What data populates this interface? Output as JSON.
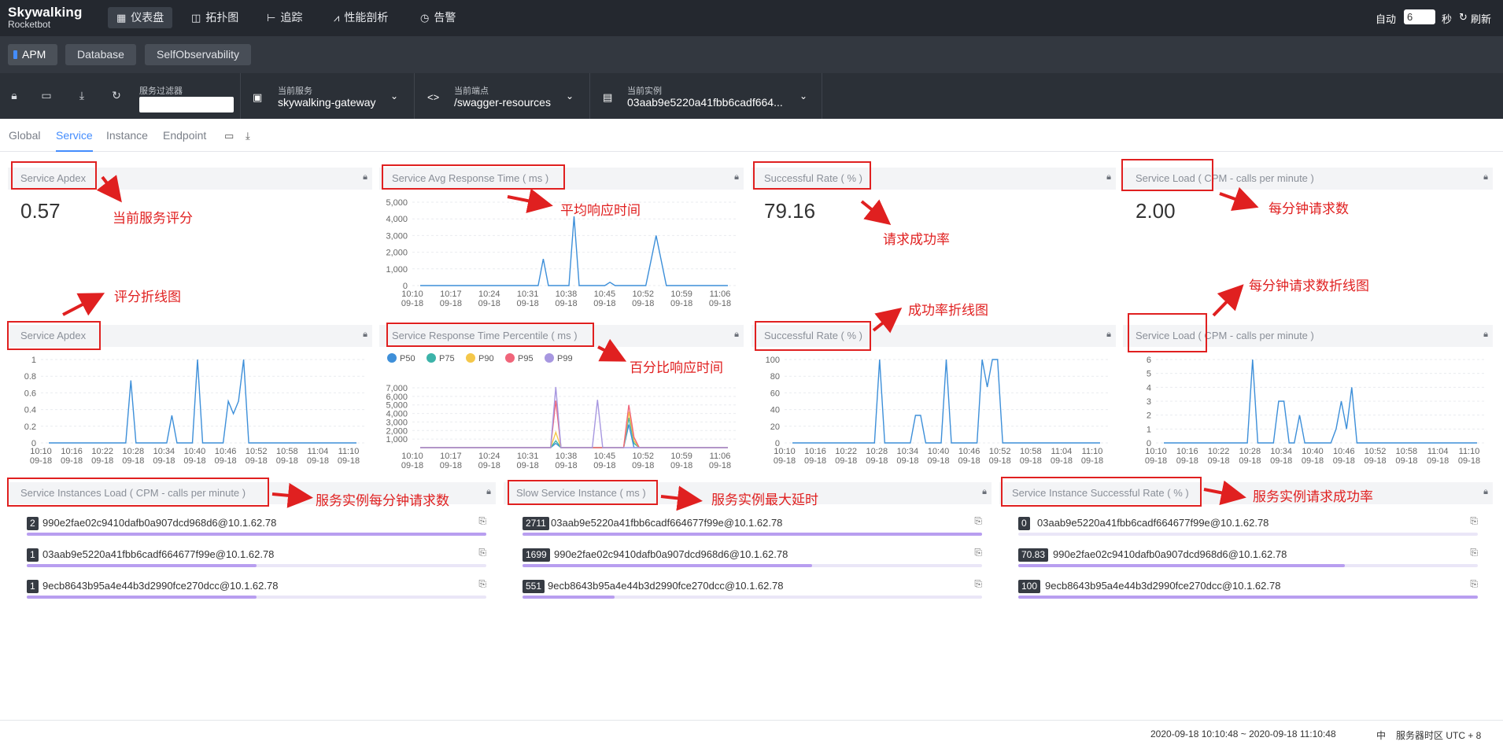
{
  "brand": {
    "line1": "Skywalking",
    "line2": "Rocketbot"
  },
  "nav": [
    {
      "icon": "dashboard-icon",
      "glyph": "▦",
      "label": "仪表盘",
      "active": true
    },
    {
      "icon": "topology-icon",
      "glyph": "◫",
      "label": "拓扑图",
      "active": false
    },
    {
      "icon": "trace-icon",
      "glyph": "⊢",
      "label": "追踪",
      "active": false
    },
    {
      "icon": "profile-icon",
      "glyph": "⩘",
      "label": "性能剖析",
      "active": false
    },
    {
      "icon": "alarm-icon",
      "glyph": "◷",
      "label": "告警",
      "active": false
    }
  ],
  "auto_refresh": {
    "auto_label": "自动",
    "interval": "6",
    "unit": "秒",
    "refresh_label": "刷新"
  },
  "dashboards": [
    {
      "label": "APM",
      "active": true
    },
    {
      "label": "Database",
      "active": false
    },
    {
      "label": "SelfObservability",
      "active": false
    }
  ],
  "toolbar": {
    "filter_label": "服务过滤器",
    "service": {
      "label": "当前服务",
      "value": "skywalking-gateway"
    },
    "endpoint": {
      "label": "当前端点",
      "value": "/swagger-resources"
    },
    "instance": {
      "label": "当前实例",
      "value": "03aab9e5220a41fbb6cadf664..."
    }
  },
  "tabs": [
    {
      "label": "Global",
      "active": false
    },
    {
      "label": "Service",
      "active": true
    },
    {
      "label": "Instance",
      "active": false
    },
    {
      "label": "Endpoint",
      "active": false
    }
  ],
  "row1": {
    "apdex": {
      "title": "Service Apdex",
      "value": "0.57"
    },
    "avg_rt": {
      "title": "Service Avg Response Time ( ms )"
    },
    "success": {
      "title": "Successful Rate ( % )",
      "value": "79.16"
    },
    "load": {
      "title": "Service Load ( CPM - calls per minute )",
      "value": "2.00"
    }
  },
  "row2": {
    "apdex": {
      "title": "Service Apdex"
    },
    "percentile": {
      "title": "Service Response Time Percentile ( ms )"
    },
    "success": {
      "title": "Successful Rate ( % )"
    },
    "load": {
      "title": "Service Load ( CPM - calls per minute )"
    }
  },
  "row3": {
    "instances_load": {
      "title": "Service Instances Load ( CPM - calls per minute )",
      "items": [
        {
          "value": "2",
          "name": "990e2fae02c9410dafb0a907dcd968d6@10.1.62.78",
          "ratio": 1.0
        },
        {
          "value": "1",
          "name": "03aab9e5220a41fbb6cadf664677f99e@10.1.62.78",
          "ratio": 0.5
        },
        {
          "value": "1",
          "name": "9ecb8643b95a4e44b3d2990fce270dcc@10.1.62.78",
          "ratio": 0.5
        }
      ]
    },
    "slow_instance": {
      "title": "Slow Service Instance ( ms )",
      "items": [
        {
          "value": "2711",
          "name": "03aab9e5220a41fbb6cadf664677f99e@10.1.62.78",
          "ratio": 1.0
        },
        {
          "value": "1699",
          "name": "990e2fae02c9410dafb0a907dcd968d6@10.1.62.78",
          "ratio": 0.63
        },
        {
          "value": "551",
          "name": "9ecb8643b95a4e44b3d2990fce270dcc@10.1.62.78",
          "ratio": 0.2
        }
      ]
    },
    "instance_success": {
      "title": "Service Instance Successful Rate ( % )",
      "items": [
        {
          "value": "0",
          "name": "03aab9e5220a41fbb6cadf664677f99e@10.1.62.78",
          "ratio": 0.0
        },
        {
          "value": "70.83",
          "name": "990e2fae02c9410dafb0a907dcd968d6@10.1.62.78",
          "ratio": 0.71
        },
        {
          "value": "100",
          "name": "9ecb8643b95a4e44b3d2990fce270dcc@10.1.62.78",
          "ratio": 1.0
        }
      ]
    }
  },
  "annotations": {
    "a1": "当前服务评分",
    "a2": "平均响应时间",
    "a3": "请求成功率",
    "a4": "每分钟请求数",
    "a5": "评分折线图",
    "a6": "百分比响应时间",
    "a7": "成功率折线图",
    "a8": "每分钟请求数折线图",
    "a9": "服务实例每分钟请求数",
    "a10": "服务实例最大延时",
    "a11": "服务实例请求成功率"
  },
  "footer": {
    "range": "2020-09-18 10:10:48 ~ 2020-09-18 11:10:48",
    "lang": "中",
    "timezone": "服务器时区 UTC + 8"
  },
  "colors": {
    "accent": "#448dfe",
    "line": "#3d8fd9",
    "annotation": "#e02020"
  },
  "chart_data": [
    {
      "id": "avg_rt",
      "type": "line",
      "yticks": [
        "0",
        "1,000",
        "2,000",
        "3,000",
        "4,000",
        "5,000"
      ],
      "ylim": [
        0,
        5000
      ],
      "xticks": [
        [
          "10:10",
          "09-18"
        ],
        [
          "10:17",
          "09-18"
        ],
        [
          "10:24",
          "09-18"
        ],
        [
          "10:31",
          "09-18"
        ],
        [
          "10:38",
          "09-18"
        ],
        [
          "10:45",
          "09-18"
        ],
        [
          "10:52",
          "09-18"
        ],
        [
          "10:59",
          "09-18"
        ],
        [
          "11:06",
          "09-18"
        ]
      ],
      "series": [
        {
          "values": [
            0,
            0,
            0,
            0,
            0,
            0,
            0,
            0,
            0,
            0,
            0,
            0,
            0,
            0,
            0,
            0,
            0,
            0,
            0,
            0,
            0,
            0,
            0,
            0,
            1600,
            0,
            0,
            0,
            0,
            0,
            4150,
            0,
            0,
            0,
            0,
            0,
            0,
            200,
            0,
            0,
            0,
            0,
            0,
            0,
            0,
            1500,
            3000,
            1500,
            0,
            0,
            0,
            0,
            0,
            0,
            0,
            0,
            0,
            0,
            0,
            0,
            0
          ]
        }
      ]
    },
    {
      "id": "apdex_line",
      "type": "line",
      "yticks": [
        "0",
        "0.2",
        "0.4",
        "0.6",
        "0.8",
        "1"
      ],
      "ylim": [
        0,
        1
      ],
      "xticks": [
        [
          "10:10",
          "09-18"
        ],
        [
          "10:16",
          "09-18"
        ],
        [
          "10:22",
          "09-18"
        ],
        [
          "10:28",
          "09-18"
        ],
        [
          "10:34",
          "09-18"
        ],
        [
          "10:40",
          "09-18"
        ],
        [
          "10:46",
          "09-18"
        ],
        [
          "10:52",
          "09-18"
        ],
        [
          "10:58",
          "09-18"
        ],
        [
          "11:04",
          "09-18"
        ],
        [
          "11:10",
          "09-18"
        ]
      ],
      "series": [
        {
          "values": [
            0,
            0,
            0,
            0,
            0,
            0,
            0,
            0,
            0,
            0,
            0,
            0,
            0,
            0,
            0,
            0,
            0.75,
            0,
            0,
            0,
            0,
            0,
            0,
            0,
            0.33,
            0,
            0,
            0,
            0,
            1,
            0,
            0,
            0,
            0,
            0,
            0.5,
            0.35,
            0.5,
            1,
            0,
            0,
            0,
            0,
            0,
            0,
            0,
            0,
            0,
            0,
            0,
            0,
            0,
            0,
            0,
            0,
            0,
            0,
            0,
            0,
            0,
            0
          ]
        }
      ]
    },
    {
      "id": "percentile",
      "type": "line",
      "yticks": [
        "1,000",
        "2,000",
        "3,000",
        "4,000",
        "5,000",
        "6,000",
        "7,000"
      ],
      "ylim": [
        0,
        7000
      ],
      "legend": [
        "P50",
        "P75",
        "P90",
        "P95",
        "P99"
      ],
      "legend_colors": [
        "#3e8fd9",
        "#3cb3a9",
        "#f4c74a",
        "#f0657a",
        "#a797e0"
      ],
      "xticks": [
        [
          "10:10",
          "09-18"
        ],
        [
          "10:17",
          "09-18"
        ],
        [
          "10:24",
          "09-18"
        ],
        [
          "10:31",
          "09-18"
        ],
        [
          "10:38",
          "09-18"
        ],
        [
          "10:45",
          "09-18"
        ],
        [
          "10:52",
          "09-18"
        ],
        [
          "10:59",
          "09-18"
        ],
        [
          "11:06",
          "09-18"
        ]
      ],
      "series": [
        {
          "name": "P50",
          "values": [
            0,
            0,
            0,
            0,
            0,
            0,
            0,
            0,
            0,
            0,
            0,
            0,
            0,
            0,
            0,
            0,
            0,
            0,
            0,
            0,
            0,
            0,
            0,
            0,
            0,
            0,
            500,
            0,
            0,
            0,
            0,
            0,
            0,
            0,
            0,
            0,
            0,
            0,
            0,
            0,
            2700,
            0,
            0,
            0,
            0,
            0,
            0,
            0,
            0,
            0,
            0,
            0,
            0,
            0,
            0,
            0,
            0,
            0,
            0,
            0
          ]
        },
        {
          "name": "P75",
          "values": [
            0,
            0,
            0,
            0,
            0,
            0,
            0,
            0,
            0,
            0,
            0,
            0,
            0,
            0,
            0,
            0,
            0,
            0,
            0,
            0,
            0,
            0,
            0,
            0,
            0,
            0,
            800,
            0,
            0,
            0,
            0,
            0,
            0,
            0,
            0,
            0,
            0,
            0,
            0,
            0,
            3500,
            500,
            0,
            0,
            0,
            0,
            0,
            0,
            0,
            0,
            0,
            0,
            0,
            0,
            0,
            0,
            0,
            0,
            0,
            0
          ]
        },
        {
          "name": "P90",
          "values": [
            0,
            0,
            0,
            0,
            0,
            0,
            0,
            0,
            0,
            0,
            0,
            0,
            0,
            0,
            0,
            0,
            0,
            0,
            0,
            0,
            0,
            0,
            0,
            0,
            0,
            0,
            1800,
            0,
            0,
            0,
            0,
            0,
            0,
            0,
            0,
            0,
            0,
            0,
            0,
            0,
            4200,
            800,
            0,
            0,
            0,
            0,
            0,
            0,
            0,
            0,
            0,
            0,
            0,
            0,
            0,
            0,
            0,
            0,
            0,
            0
          ]
        },
        {
          "name": "P95",
          "values": [
            0,
            0,
            0,
            0,
            0,
            0,
            0,
            0,
            0,
            0,
            0,
            0,
            0,
            0,
            0,
            0,
            0,
            0,
            0,
            0,
            0,
            0,
            0,
            0,
            0,
            0,
            5500,
            0,
            0,
            0,
            0,
            0,
            0,
            0,
            0,
            0,
            0,
            0,
            0,
            0,
            5000,
            1200,
            0,
            0,
            0,
            0,
            0,
            0,
            0,
            0,
            0,
            0,
            0,
            0,
            0,
            0,
            0,
            0,
            0,
            0
          ]
        },
        {
          "name": "P99",
          "values": [
            0,
            0,
            0,
            0,
            0,
            0,
            0,
            0,
            0,
            0,
            0,
            0,
            0,
            0,
            0,
            0,
            0,
            0,
            0,
            0,
            0,
            0,
            0,
            0,
            0,
            0,
            7100,
            0,
            0,
            0,
            0,
            0,
            0,
            0,
            5600,
            0,
            0,
            0,
            0,
            0,
            0,
            0,
            0,
            0,
            0,
            0,
            0,
            0,
            0,
            0,
            0,
            0,
            0,
            0,
            0,
            0,
            0,
            0,
            0,
            0
          ]
        }
      ]
    },
    {
      "id": "success_line",
      "type": "line",
      "yticks": [
        "0",
        "20",
        "40",
        "60",
        "80",
        "100"
      ],
      "ylim": [
        0,
        100
      ],
      "xticks": [
        [
          "10:10",
          "09-18"
        ],
        [
          "10:16",
          "09-18"
        ],
        [
          "10:22",
          "09-18"
        ],
        [
          "10:28",
          "09-18"
        ],
        [
          "10:34",
          "09-18"
        ],
        [
          "10:40",
          "09-18"
        ],
        [
          "10:46",
          "09-18"
        ],
        [
          "10:52",
          "09-18"
        ],
        [
          "10:58",
          "09-18"
        ],
        [
          "11:04",
          "09-18"
        ],
        [
          "11:10",
          "09-18"
        ]
      ],
      "series": [
        {
          "values": [
            0,
            0,
            0,
            0,
            0,
            0,
            0,
            0,
            0,
            0,
            0,
            0,
            0,
            0,
            0,
            0,
            0,
            100,
            0,
            0,
            0,
            0,
            0,
            0,
            33,
            33,
            0,
            0,
            0,
            0,
            100,
            0,
            0,
            0,
            0,
            0,
            0,
            100,
            67,
            100,
            100,
            0,
            0,
            0,
            0,
            0,
            0,
            0,
            0,
            0,
            0,
            0,
            0,
            0,
            0,
            0,
            0,
            0,
            0,
            0,
            0
          ]
        }
      ]
    },
    {
      "id": "load_line",
      "type": "line",
      "yticks": [
        "0",
        "1",
        "2",
        "3",
        "4",
        "5",
        "6"
      ],
      "ylim": [
        0,
        6
      ],
      "xticks": [
        [
          "10:10",
          "09-18"
        ],
        [
          "10:16",
          "09-18"
        ],
        [
          "10:22",
          "09-18"
        ],
        [
          "10:28",
          "09-18"
        ],
        [
          "10:34",
          "09-18"
        ],
        [
          "10:40",
          "09-18"
        ],
        [
          "10:46",
          "09-18"
        ],
        [
          "10:52",
          "09-18"
        ],
        [
          "10:58",
          "09-18"
        ],
        [
          "11:04",
          "09-18"
        ],
        [
          "11:10",
          "09-18"
        ]
      ],
      "series": [
        {
          "values": [
            0,
            0,
            0,
            0,
            0,
            0,
            0,
            0,
            0,
            0,
            0,
            0,
            0,
            0,
            0,
            0,
            0,
            6,
            0,
            0,
            0,
            0,
            3,
            3,
            0,
            0,
            2,
            0,
            0,
            0,
            0,
            0,
            0,
            1,
            3,
            1,
            4,
            0,
            0,
            0,
            0,
            0,
            0,
            0,
            0,
            0,
            0,
            0,
            0,
            0,
            0,
            0,
            0,
            0,
            0,
            0,
            0,
            0,
            0,
            0,
            0
          ]
        }
      ]
    }
  ]
}
